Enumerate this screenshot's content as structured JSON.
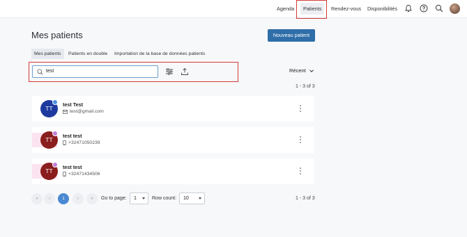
{
  "nav": {
    "items": [
      {
        "label": "Agenda"
      },
      {
        "label": "Patients"
      },
      {
        "label": "Rendez-vous"
      },
      {
        "label": "Disponibilités"
      }
    ]
  },
  "header": {
    "title": "Mes patients",
    "new_button": "Nouveau patient"
  },
  "tabs": [
    {
      "label": "Mes patients"
    },
    {
      "label": "Patients en double"
    },
    {
      "label": "Importation de la base de données patients"
    }
  ],
  "search": {
    "value": "test"
  },
  "sort": {
    "label": "Récent"
  },
  "count_text": "1 - 3 of 3",
  "patients": [
    {
      "initials": "TT",
      "name": "test Test",
      "contact": "test@gmail.com",
      "contact_icon": "mail-icon",
      "avatar_color": "#1e3a9e",
      "badge_color": "#4a90e2"
    },
    {
      "initials": "TT",
      "name": "test test",
      "contact": "+32471050239",
      "contact_icon": "phone-icon",
      "avatar_color": "#8a1d1d",
      "badge_color": "#c07ed6"
    },
    {
      "initials": "TT",
      "name": "test test",
      "contact": "+32471434506",
      "contact_icon": "phone-icon",
      "avatar_color": "#8a1d1d",
      "badge_color": "#c07ed6"
    }
  ],
  "pagination": {
    "first": "«",
    "prev": "‹",
    "current": "1",
    "next": "›",
    "last": "»",
    "goto_label": "Go to page:",
    "goto_value": "1",
    "rowcount_label": "Row count:",
    "rowcount_value": "10"
  }
}
